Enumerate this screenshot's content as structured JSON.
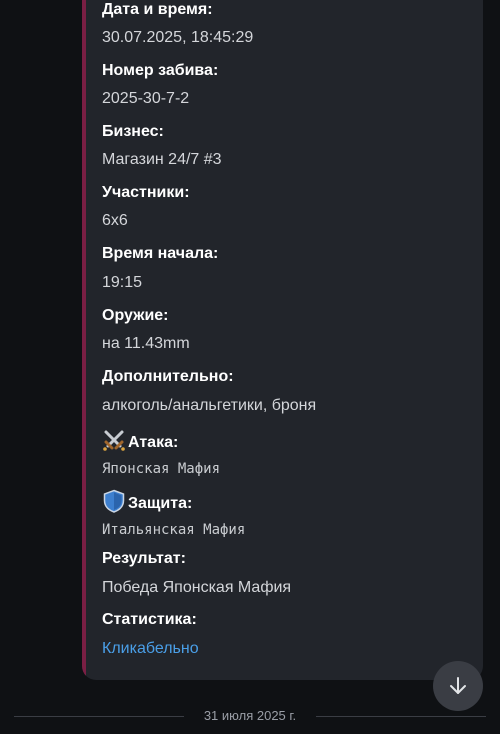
{
  "message": {
    "fields": [
      {
        "label": "Дата и время:",
        "value": "30.07.2025, 18:45:29"
      },
      {
        "label": "Номер забива:",
        "value": "2025-30-7-2"
      },
      {
        "label": "Бизнес:",
        "value": "Магазин 24/7 #3"
      },
      {
        "label": "Участники:",
        "value": "6x6"
      },
      {
        "label": "Время начала:",
        "value": "19:15"
      },
      {
        "label": "Оружие:",
        "value": "на 11.43mm"
      },
      {
        "label": "Дополнительно:",
        "value": "алкоголь/анальгетики, броня"
      },
      {
        "label": "Атака:",
        "value": "Японская Мафия",
        "icon": "crossed-swords-icon"
      },
      {
        "label": "Защита:",
        "value": "Итальянская Мафия",
        "icon": "shield-icon"
      },
      {
        "label": "Результат:",
        "value": "Победа Японская Мафия"
      },
      {
        "label": "Статистика:",
        "value": "Кликабельно"
      }
    ]
  },
  "date_separator": "31 июля 2025 г.",
  "colors": {
    "background": "#0f1114",
    "bubble": "#22252b",
    "accent_bar": "#7a1f44",
    "link": "#4a9fe8"
  }
}
